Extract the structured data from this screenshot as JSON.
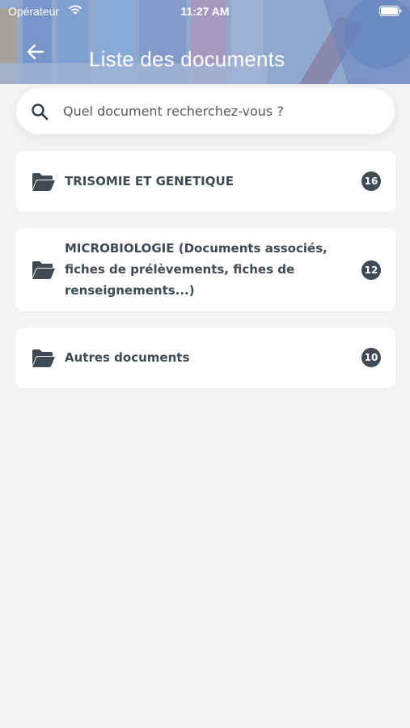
{
  "status_bar": {
    "carrier": "Opérateur",
    "time": "11:27 AM"
  },
  "header": {
    "title": "Liste des documents"
  },
  "search": {
    "placeholder": "Quel document recherchez-vous ?"
  },
  "folders": [
    {
      "label": "TRISOMIE ET GENETIQUE",
      "count": "16"
    },
    {
      "label": "MICROBIOLOGIE (Documents associés, fiches de prélèvements, fiches de renseignements...)",
      "count": "12"
    },
    {
      "label": "Autres documents",
      "count": "10"
    }
  ],
  "colors": {
    "accent": "#3f4a54",
    "background": "#f4f4f4",
    "card": "#ffffff"
  }
}
